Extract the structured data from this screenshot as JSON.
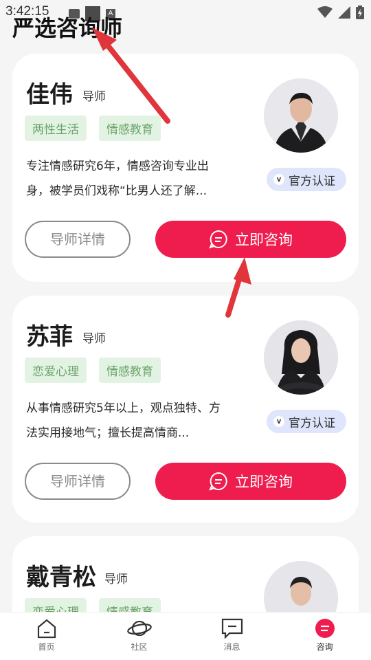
{
  "status_bar": {
    "time": "3:42:15"
  },
  "page": {
    "title": "严选咨询师"
  },
  "counselors": [
    {
      "name": "佳伟",
      "role": "导师",
      "tags": [
        "两性生活",
        "情感教育"
      ],
      "description": "专注情感研究6年，情感咨询专业出身，被学员们戏称“比男人还了解...",
      "badge": "官方认证",
      "detail_label": "导师详情",
      "consult_label": "立即咨询"
    },
    {
      "name": "苏菲",
      "role": "导师",
      "tags": [
        "恋爱心理",
        "情感教育"
      ],
      "description": "从事情感研究5年以上，观点独特、方法实用接地气；擅长提高情商...",
      "badge": "官方认证",
      "detail_label": "导师详情",
      "consult_label": "立即咨询"
    },
    {
      "name": "戴青松",
      "role": "导师",
      "tags": [
        "恋爱心理",
        "情感教育"
      ]
    }
  ],
  "tabbar": [
    {
      "label": "首页",
      "icon": "home-icon"
    },
    {
      "label": "社区",
      "icon": "planet-icon"
    },
    {
      "label": "消息",
      "icon": "message-icon"
    },
    {
      "label": "咨询",
      "icon": "consult-icon",
      "active": true
    }
  ],
  "colors": {
    "accent": "#ef1c4e",
    "tag_bg": "#e3f3e3",
    "tag_text": "#6aa36a",
    "badge_bg": "#dfe6fb",
    "annotation_arrow": "#e0353a"
  }
}
